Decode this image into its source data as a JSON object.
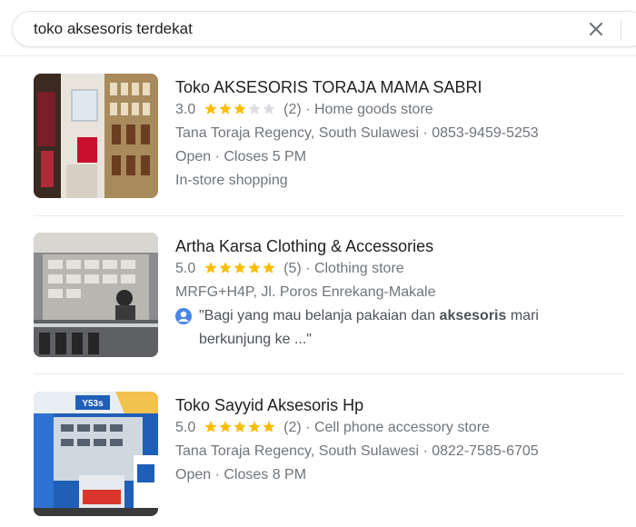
{
  "search": {
    "query": "toko aksesoris terdekat",
    "clear_icon": "close-icon"
  },
  "colors": {
    "star": "#fbbc04",
    "star_empty": "#dadce0",
    "meta_text": "#70757a",
    "title_text": "#202124",
    "divider": "#ebebeb"
  },
  "results": [
    {
      "name": "Toko AKSESORIS TORAJA MAMA SABRI",
      "rating": "3.0",
      "stars": 3,
      "reviews": "(2)",
      "category": "· Home goods store",
      "address": "Tana Toraja Regency, South Sulawesi · 0853-9459-5253",
      "hours": "Open · Closes 5 PM",
      "extra": "In-store shopping"
    },
    {
      "name": "Artha Karsa Clothing & Accessories",
      "rating": "5.0",
      "stars": 5,
      "reviews": "(5)",
      "category": "· Clothing store",
      "address": "MRFG+H4P, Jl. Poros Enrekang-Makale",
      "review_pre": "\"Bagi yang mau belanja pakaian dan ",
      "review_bold": "aksesoris",
      "review_post": " mari",
      "review_line2": "berkunjung ke ...\""
    },
    {
      "name": "Toko Sayyid Aksesoris Hp",
      "rating": "5.0",
      "stars": 5,
      "reviews": "(2)",
      "category": "· Cell phone accessory store",
      "address": "Tana Toraja Regency, South Sulawesi · 0822-7585-6705",
      "hours": "Open · Closes 8 PM",
      "sign_text": "Y53s"
    }
  ]
}
